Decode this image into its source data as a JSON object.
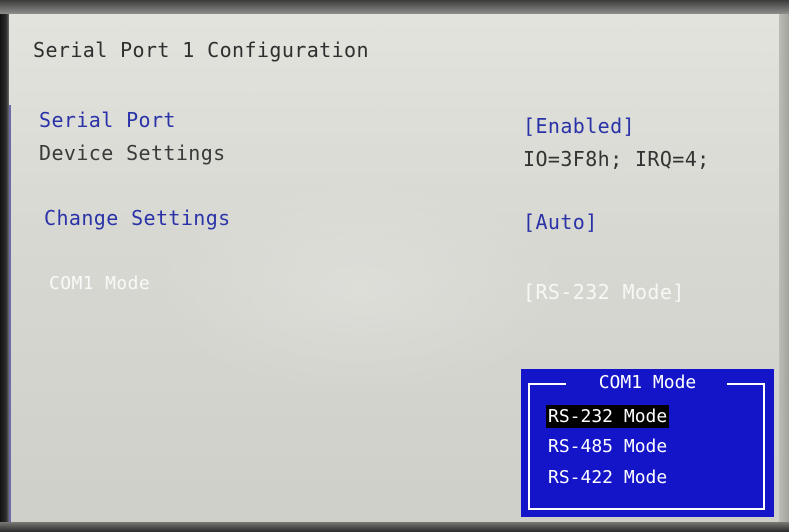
{
  "page_title": "Serial Port 1 Configuration",
  "settings": [
    {
      "label": "Serial Port",
      "value": "[Enabled]"
    },
    {
      "label": "Device Settings",
      "value": "IO=3F8h; IRQ=4;"
    },
    {
      "label": "Change Settings",
      "value": "[Auto]"
    },
    {
      "label": "COM1 Mode",
      "value": "[RS-232 Mode]"
    }
  ],
  "popup": {
    "title": "COM1 Mode",
    "options": [
      "RS-232 Mode",
      "RS-485 Mode",
      "RS-422 Mode"
    ],
    "selected": "RS-232 Mode"
  },
  "colors": {
    "popup_background": "#1414c8",
    "selectable_text": "#2a32a8",
    "highlight": "#000000"
  }
}
